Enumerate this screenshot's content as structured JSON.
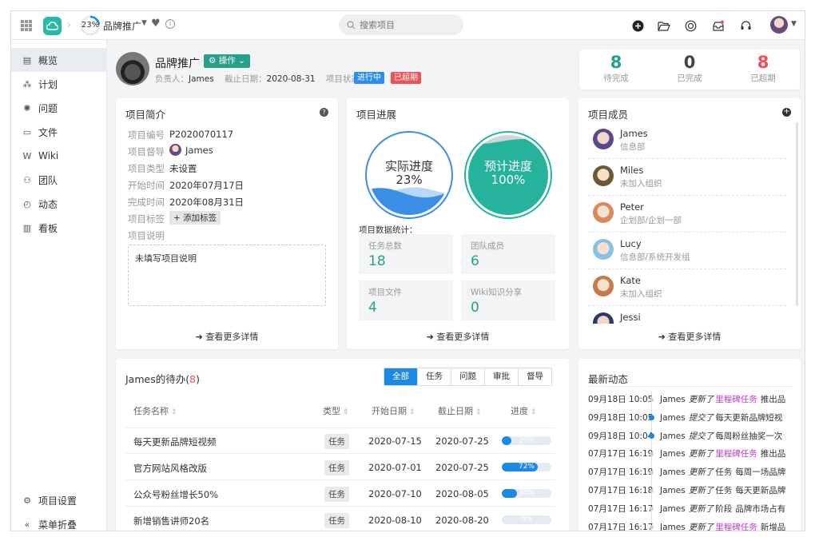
{
  "topbar": {
    "progress_text": "23%",
    "progress_value": 0.23,
    "project_name": "品牌推广",
    "search_placeholder": "搜索项目"
  },
  "sidebar": {
    "items": [
      {
        "label": "概览",
        "icon": "overview-icon"
      },
      {
        "label": "计划",
        "icon": "plan-icon"
      },
      {
        "label": "问题",
        "icon": "bug-icon"
      },
      {
        "label": "文件",
        "icon": "folder-icon"
      },
      {
        "label": "Wiki",
        "icon": "wiki-icon"
      },
      {
        "label": "团队",
        "icon": "team-icon"
      },
      {
        "label": "动态",
        "icon": "activity-icon"
      },
      {
        "label": "看板",
        "icon": "board-icon"
      }
    ],
    "settings_label": "项目设置",
    "collapse_label": "菜单折叠"
  },
  "header": {
    "title": "品牌推广",
    "action_label": "操作",
    "owner_label": "负责人：",
    "owner": "James",
    "deadline_label": "截止日期：",
    "deadline": "2020-08-31",
    "status_label": "项目状态：",
    "status_active": "进行中",
    "status_overdue": "已超期"
  },
  "summary": {
    "pending": {
      "value": "8",
      "label": "待完成",
      "color": "#26a08a"
    },
    "done": {
      "value": "0",
      "label": "已完成",
      "color": "#444444"
    },
    "overdue": {
      "value": "8",
      "label": "已超期",
      "color": "#f0505a"
    }
  },
  "intro": {
    "title": "项目简介",
    "fields": [
      {
        "label": "项目编号",
        "value": "P2020070117"
      },
      {
        "label": "项目督导",
        "value": "James"
      },
      {
        "label": "项目类型",
        "value": "未设置"
      },
      {
        "label": "开始时间",
        "value": "2020年07月17日"
      },
      {
        "label": "完成时间",
        "value": "2020年08月31日"
      },
      {
        "label": "项目标签",
        "value": "+ 添加标签"
      },
      {
        "label": "项目说明",
        "value": ""
      }
    ],
    "desc_placeholder": "未填写项目说明",
    "more": "查看更多详情"
  },
  "progress": {
    "title": "项目进展",
    "actual_label": "实际进度",
    "actual_value": "23%",
    "actual_fraction": 0.23,
    "planned_label": "预计进度",
    "planned_value": "100%",
    "planned_fraction": 1.0,
    "stats_title": "项目数据统计：",
    "stats": [
      {
        "label": "任务总数",
        "value": "18"
      },
      {
        "label": "团队成员",
        "value": "6"
      },
      {
        "label": "项目文件",
        "value": "4"
      },
      {
        "label": "Wiki知识分享",
        "value": "0"
      }
    ],
    "more": "查看更多详情"
  },
  "members": {
    "title": "项目成员",
    "list": [
      {
        "name": "James",
        "dept": "信息部"
      },
      {
        "name": "Miles",
        "dept": "未加入组织"
      },
      {
        "name": "Peter",
        "dept": "企划部/企划一部"
      },
      {
        "name": "Lucy",
        "dept": "信息部/系统开发组"
      },
      {
        "name": "Kate",
        "dept": "未加入组织"
      },
      {
        "name": "Jessi",
        "dept": ""
      }
    ],
    "more": "查看更多详情"
  },
  "todo": {
    "title_prefix": "James的待办(",
    "count": "8",
    "title_suffix": ")",
    "tabs": [
      "全部",
      "任务",
      "问题",
      "审批",
      "督导"
    ],
    "columns": [
      "任务名称",
      "类型",
      "开始日期",
      "截止日期",
      "进度"
    ],
    "rows": [
      {
        "name": "每天更新品牌短视频",
        "type": "任务",
        "start": "2020-07-15",
        "end": "2020-07-25",
        "progress": 20,
        "progress_text": "20%"
      },
      {
        "name": "官方网站风格改版",
        "type": "任务",
        "start": "2020-07-01",
        "end": "2020-07-25",
        "progress": 72,
        "progress_text": "72%"
      },
      {
        "name": "公众号粉丝增长50%",
        "type": "任务",
        "start": "2020-07-10",
        "end": "2020-08-05",
        "progress": 30,
        "progress_text": "30%"
      },
      {
        "name": "新增销售讲师20名",
        "type": "任务",
        "start": "2020-08-10",
        "end": "2020-08-20",
        "progress": 0,
        "progress_text": "0%"
      }
    ]
  },
  "activity": {
    "title": "最新动态",
    "items": [
      {
        "time": "09月18日 10:05",
        "user": "James",
        "verb": "更新了",
        "kind": "里程碑任务",
        "text": "推出品",
        "hl": false,
        "kind_color": "#c03ad0"
      },
      {
        "time": "09月18日 10:05",
        "user": "James",
        "verb": "提交了",
        "kind": "",
        "text": "每天更新品牌短视",
        "hl": true,
        "kind_color": "#333333"
      },
      {
        "time": "09月18日 10:04",
        "user": "James",
        "verb": "提交了",
        "kind": "",
        "text": "每周粉丝抽奖一次",
        "hl": true,
        "kind_color": "#333333"
      },
      {
        "time": "07月17日 16:19",
        "user": "James",
        "verb": "更新了",
        "kind": "里程碑任务",
        "text": "推出品",
        "hl": false,
        "kind_color": "#c03ad0"
      },
      {
        "time": "07月17日 16:19",
        "user": "James",
        "verb": "更新了",
        "kind": "任务",
        "text": "每周一场品牌",
        "hl": false,
        "kind_color": "#333333"
      },
      {
        "time": "07月17日 16:18",
        "user": "James",
        "verb": "更新了",
        "kind": "任务",
        "text": "每天更新品牌",
        "hl": false,
        "kind_color": "#333333"
      },
      {
        "time": "07月17日 16:17",
        "user": "James",
        "verb": "更新了",
        "kind": "阶段",
        "text": "品牌市场占有",
        "hl": false,
        "kind_color": "#333333"
      },
      {
        "time": "07月17日 16:17",
        "user": "James",
        "verb": "更新了",
        "kind": "里程碑任务",
        "text": "新增品",
        "hl": false,
        "kind_color": "#c03ad0"
      }
    ]
  }
}
